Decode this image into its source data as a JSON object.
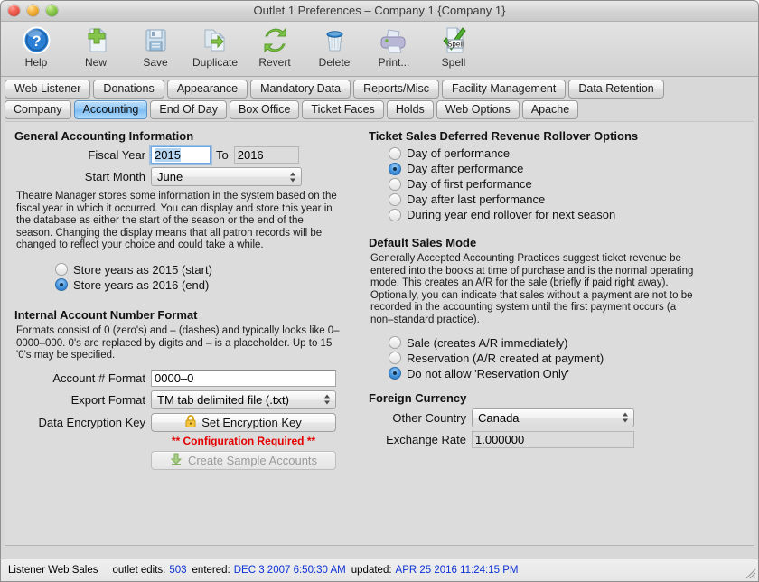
{
  "window": {
    "title": "Outlet 1 Preferences – Company 1 {Company 1}"
  },
  "toolbar": {
    "items": [
      {
        "label": "Help",
        "icon": "help-icon"
      },
      {
        "label": "New",
        "icon": "new-document-icon"
      },
      {
        "label": "Save",
        "icon": "save-floppy-icon"
      },
      {
        "label": "Duplicate",
        "icon": "duplicate-icon"
      },
      {
        "label": "Revert",
        "icon": "revert-refresh-icon"
      },
      {
        "label": "Delete",
        "icon": "trash-icon"
      },
      {
        "label": "Print...",
        "icon": "printer-icon"
      },
      {
        "label": "Spell",
        "icon": "spell-check-icon"
      }
    ]
  },
  "tabs": {
    "row1": [
      {
        "label": "Web Listener",
        "selected": false
      },
      {
        "label": "Donations",
        "selected": false
      },
      {
        "label": "Appearance",
        "selected": false
      },
      {
        "label": "Mandatory Data",
        "selected": false
      },
      {
        "label": "Reports/Misc",
        "selected": false
      },
      {
        "label": "Facility Management",
        "selected": false
      },
      {
        "label": "Data Retention",
        "selected": false
      }
    ],
    "row2": [
      {
        "label": "Company",
        "selected": false
      },
      {
        "label": "Accounting",
        "selected": true
      },
      {
        "label": "End Of Day",
        "selected": false
      },
      {
        "label": "Box Office",
        "selected": false
      },
      {
        "label": "Ticket Faces",
        "selected": false
      },
      {
        "label": "Holds",
        "selected": false
      },
      {
        "label": "Web Options",
        "selected": false
      },
      {
        "label": "Apache",
        "selected": false
      }
    ]
  },
  "general_accounting": {
    "heading": "General Accounting Information",
    "fiscal_year_label": "Fiscal Year",
    "fiscal_year_value": "2015",
    "to_label": "To",
    "fiscal_year_to_value": "2016",
    "start_month_label": "Start Month",
    "start_month_value": "June",
    "description": "Theatre Manager stores some information in the system based on the fiscal year in which it occurred.  You can display and store this year in the database as either the start of the season or the end of the season.   Changing the display means that all patron records will be changed to reflect your choice and could take a while.",
    "store_options": [
      {
        "label": "Store years as 2015 (start)",
        "selected": false
      },
      {
        "label": "Store years as 2016 (end)",
        "selected": true
      }
    ]
  },
  "account_format": {
    "heading": "Internal Account Number Format",
    "description": "Formats consist of 0 (zero's) and – (dashes) and typically looks like 0–0000–000.  0's are replaced by digits and – is a placeholder.  Up to 15 '0's may be specified.",
    "account_format_label": "Account # Format",
    "account_format_value": "0000–0",
    "export_format_label": "Export Format",
    "export_format_value": "TM tab delimited file (.txt)",
    "encryption_key_label": "Data Encryption Key",
    "encryption_key_button": "Set Encryption Key",
    "encryption_key_icon": "lock-icon",
    "config_required_warning": "** Configuration Required **",
    "create_sample_button": "Create Sample Accounts",
    "create_sample_icon": "download-arrow-icon"
  },
  "deferred_revenue": {
    "heading": "Ticket Sales Deferred Revenue Rollover Options",
    "options": [
      {
        "label": "Day of performance",
        "selected": false
      },
      {
        "label": "Day after performance",
        "selected": true
      },
      {
        "label": "Day of first performance",
        "selected": false
      },
      {
        "label": "Day after last performance",
        "selected": false
      },
      {
        "label": "During year end rollover for next season",
        "selected": false
      }
    ]
  },
  "sales_mode": {
    "heading": "Default Sales Mode",
    "description": "Generally Accepted Accounting Practices suggest ticket revenue be entered into the books at time of purchase and is the normal operating mode.  This creates an A/R for the sale (briefly if paid right away).   Optionally, you can indicate that sales without a payment are not to be recorded in the accounting system until the first payment occurs (a non–standard practice).",
    "options": [
      {
        "label": "Sale (creates A/R immediately)",
        "selected": false
      },
      {
        "label": "Reservation (A/R created at payment)",
        "selected": false
      },
      {
        "label": "Do not allow 'Reservation Only'",
        "selected": true
      }
    ]
  },
  "foreign_currency": {
    "heading": "Foreign Currency",
    "country_label": "Other Country",
    "country_value": "Canada",
    "exchange_rate_label": "Exchange Rate",
    "exchange_rate_value": "1.000000"
  },
  "statusbar": {
    "source": "Listener Web Sales",
    "edits_label": "outlet edits:",
    "edits_value": "503",
    "entered_label": "entered:",
    "entered_value": "DEC 3 2007 6:50:30 AM",
    "updated_label": "updated:",
    "updated_value": "APR 25 2016 11:24:15 PM"
  },
  "colors": {
    "accent_blue": "#7cbcf3",
    "warning_red": "#e40000",
    "status_value_blue": "#0b31d4"
  }
}
